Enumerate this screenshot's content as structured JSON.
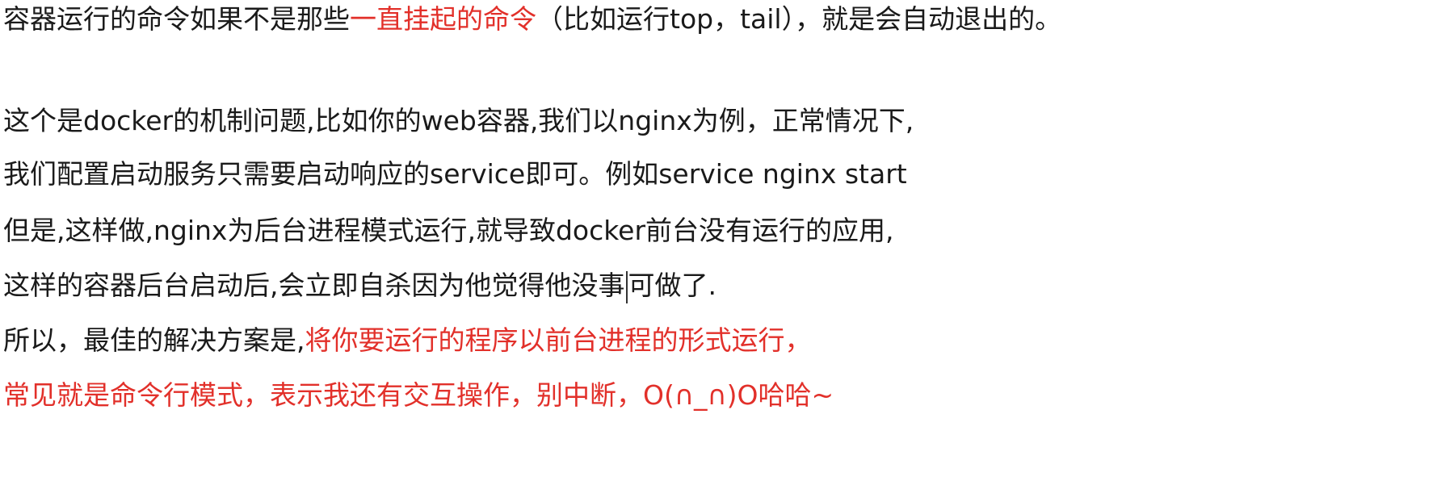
{
  "document": {
    "line1": {
      "a": "容器运行的命令如果不是那些",
      "b": "一直挂起的命令",
      "c": "（比如运行top，tail），就是会自动退出的。"
    },
    "line2": "这个是docker的机制问题,比如你的web容器,我们以nginx为例，正常情况下,",
    "line3": "我们配置启动服务只需要启动响应的service即可。例如service nginx start",
    "line4": "但是,这样做,nginx为后台进程模式运行,就导致docker前台没有运行的应用,",
    "line5": {
      "a": "这样的容器后台启动后,会立即自杀因为他觉得他没事",
      "b": "可做了."
    },
    "line6": {
      "a": "所以，最佳的解决方案是,",
      "b": "将你要运行的程序以前台进程的形式运行，"
    },
    "line7": "常见就是命令行模式，表示我还有交互操作，别中断，O(∩_∩)O哈哈~"
  },
  "colors": {
    "text": "#1a1a1a",
    "highlight": "#e2302a",
    "background": "#ffffff"
  }
}
